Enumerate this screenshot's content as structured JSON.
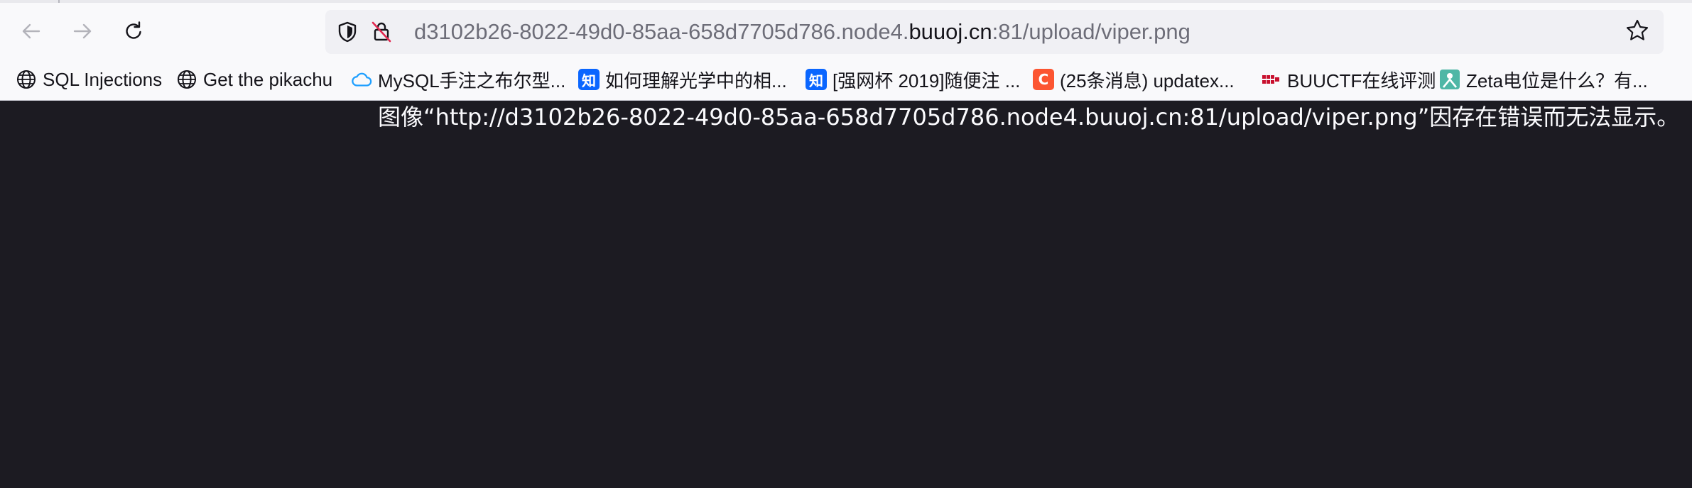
{
  "browser": {
    "nav": {
      "back_icon": "arrow-left-icon",
      "forward_icon": "arrow-right-icon",
      "reload_icon": "reload-icon"
    },
    "urlbar": {
      "url_prefix": "d3102b26-8022-49d0-85aa-658d7705d786.node4.",
      "url_host": "buuoj.cn",
      "url_suffix": ":81/upload/viper.png",
      "tracking_icon": "shield-icon",
      "insecure_icon": "insecure-lock-icon",
      "bookmark_icon": "star-icon"
    },
    "bookmarks": [
      {
        "label": "SQL Injections",
        "icon": "globe-icon"
      },
      {
        "label": "Get the pikachu",
        "icon": "globe-icon"
      },
      {
        "label": "MySQL手注之布尔型...",
        "icon": "cloud-icon"
      },
      {
        "label": "如何理解光学中的相...",
        "icon": "zhihu-icon",
        "badge": "知"
      },
      {
        "label": "[强网杯 2019]随便注 ...",
        "icon": "zhihu-icon",
        "badge": "知"
      },
      {
        "label": "(25条消息) updatex...",
        "icon": "csdn-icon",
        "badge": "C"
      },
      {
        "label": "BUUCTF在线评测",
        "icon": "buuctf-icon"
      },
      {
        "label": "Zeta电位是什么？有...",
        "icon": "person-icon"
      }
    ]
  },
  "page": {
    "error_message": "图像“http://d3102b26-8022-49d0-85aa-658d7705d786.node4.buuoj.cn:81/upload/viper.png”因存在错误而无法显示。"
  },
  "colors": {
    "chrome_bg": "#f9f9fb",
    "urlbar_bg": "#f0f0f4",
    "content_bg": "#1c1b22",
    "error_text": "#fbfbfe",
    "zhihu_blue": "#0a66ff",
    "csdn_red": "#fc5531",
    "cloud_blue": "#1e9fff",
    "person_teal": "#4fb7a6"
  }
}
